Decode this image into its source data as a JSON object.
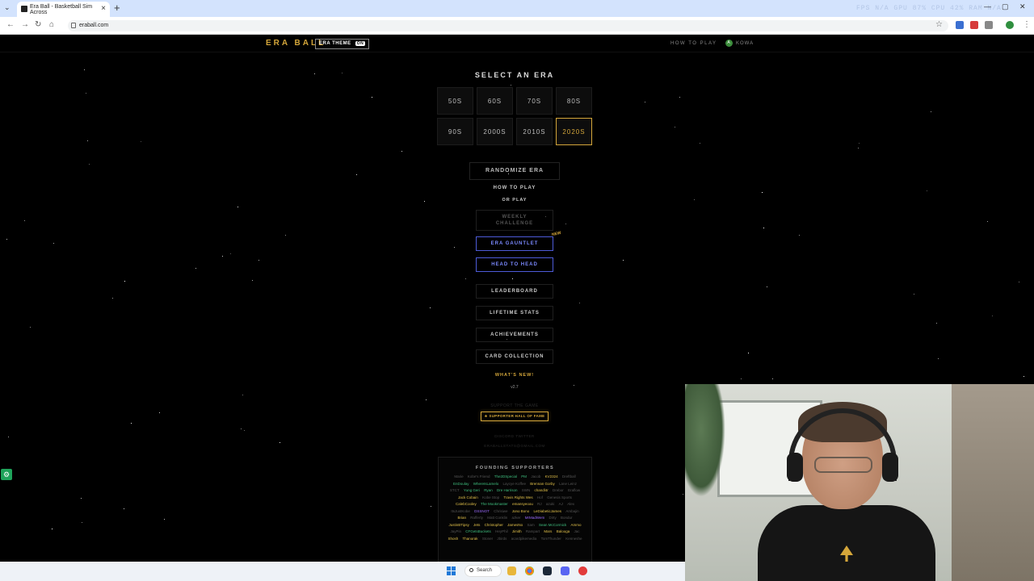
{
  "browser": {
    "tab_title": "Era Ball - Basketball Sim Across",
    "new_tab": "+",
    "url": "eraball.com",
    "stats": "FPS N/A   GPU 87%   CPU 42%   RAM N/A"
  },
  "site": {
    "logo": "ERA BALL",
    "era_theme_label": "ERA THEME",
    "era_theme_state": "ON",
    "how_to_play_nav": "HOW TO PLAY",
    "user_initial": "A",
    "user_name": "KOWA"
  },
  "era_select": {
    "title": "SELECT AN ERA",
    "eras": [
      "50S",
      "60S",
      "70S",
      "80S",
      "90S",
      "2000S",
      "2010S",
      "2020S"
    ],
    "selected": "2020S"
  },
  "menu": {
    "randomize": "RANDOMIZE ERA",
    "how_to_play": "HOW TO PLAY",
    "or_play": "OR PLAY",
    "weekly_challenge": "WEEKLY CHALLENGE",
    "era_gauntlet": "ERA GAUNTLET",
    "new_badge": "NEW",
    "head_to_head": "HEAD TO HEAD",
    "leaderboard": "LEADERBOARD",
    "lifetime_stats": "LIFETIME STATS",
    "achievements": "ACHIEVEMENTS",
    "card_collection": "CARD COLLECTION",
    "whats_new": "WHAT'S NEW!",
    "version": "v2.7",
    "support_text": "SUPPORT THE GAME",
    "supporter_hof": "★ SUPPORTER HALL OF FAME",
    "dim_links_1": "DISCORD   TWITTER",
    "dim_links_2": "ERABALLSTATS@GMAIL.COM"
  },
  "founders": {
    "title": "FOUNDING SUPPORTERS",
    "names": [
      {
        "n": "Marie",
        "c": "#555"
      },
      {
        "n": "Kobe's Friend",
        "c": "#555"
      },
      {
        "n": "The2DSpecial",
        "c": "#3fbf7f"
      },
      {
        "n": "PM",
        "c": "#3fbf7f"
      },
      {
        "n": "Jacob",
        "c": "#555"
      },
      {
        "n": "KV2324",
        "c": "#e2c14a"
      },
      {
        "n": "Dreftball",
        "c": "#555"
      },
      {
        "n": "EnDoulay",
        "c": "#3fbf7f"
      },
      {
        "n": "WhereIsLamelo",
        "c": "#3fbf7f"
      },
      {
        "n": "Laycye Koffee",
        "c": "#555"
      },
      {
        "n": "Brennan Gorby",
        "c": "#e2c14a"
      },
      {
        "n": "Lane Leinz",
        "c": "#555"
      },
      {
        "n": "STCT",
        "c": "#555"
      },
      {
        "n": "Yung Geri",
        "c": "#3fbf7f"
      },
      {
        "n": "Ryan",
        "c": "#3fbf7f"
      },
      {
        "n": "Dre Harrison",
        "c": "#3fbf7f"
      },
      {
        "n": "SWN",
        "c": "#555"
      },
      {
        "n": "chandl4r",
        "c": "#e2c14a"
      },
      {
        "n": "Drebor",
        "c": "#555"
      },
      {
        "n": "Eraflow",
        "c": "#555"
      },
      {
        "n": "Jack Cobain",
        "c": "#e2c14a"
      },
      {
        "n": "Kobe Stop",
        "c": "#555"
      },
      {
        "n": "Travis Rights Wes",
        "c": "#e2c14a"
      },
      {
        "n": "Hof",
        "c": "#555"
      },
      {
        "n": "Genesis Sports",
        "c": "#555"
      },
      {
        "n": "CalebCooley",
        "c": "#e2c14a"
      },
      {
        "n": "The Mookmaster",
        "c": "#3fbf7f"
      },
      {
        "n": "emansyeoou",
        "c": "#e2c14a"
      },
      {
        "n": "RJ",
        "c": "#555"
      },
      {
        "n": "azuki",
        "c": "#555"
      },
      {
        "n": "AJ",
        "c": "#555"
      },
      {
        "n": "Alex",
        "c": "#555"
      },
      {
        "n": "ItsJustKobe",
        "c": "#555"
      },
      {
        "n": "DSSNOT",
        "c": "#9b6bff"
      },
      {
        "n": "Chrisiwe",
        "c": "#555"
      },
      {
        "n": "Jono Bono",
        "c": "#e2c14a"
      },
      {
        "n": "LeDiabeticJames",
        "c": "#e2c14a"
      },
      {
        "n": "Ambajin",
        "c": "#555"
      },
      {
        "n": "Brian",
        "c": "#e2c14a"
      },
      {
        "n": "Rafferty",
        "c": "#555"
      },
      {
        "n": "Matt Conklin",
        "c": "#555"
      },
      {
        "n": "azker",
        "c": "#555"
      },
      {
        "n": "MrMadWem",
        "c": "#9b6bff"
      },
      {
        "n": "Dirty",
        "c": "#555"
      },
      {
        "n": "Bondur",
        "c": "#555"
      },
      {
        "n": "JustinBTipsy",
        "c": "#e2c14a"
      },
      {
        "n": "Jets",
        "c": "#e2c14a"
      },
      {
        "n": "Christopher",
        "c": "#e2c14a"
      },
      {
        "n": "JamesNo",
        "c": "#e2c14a"
      },
      {
        "n": "Sam",
        "c": "#555"
      },
      {
        "n": "Sean McCormick",
        "c": "#3fbf7f"
      },
      {
        "n": "Ammo",
        "c": "#e2c14a"
      },
      {
        "n": "JayPin",
        "c": "#555"
      },
      {
        "n": "CFGetsBuckets",
        "c": "#3fbf7f"
      },
      {
        "n": "HeyPhil",
        "c": "#555"
      },
      {
        "n": "Jimith",
        "c": "#e2c14a"
      },
      {
        "n": "Rampart",
        "c": "#555"
      },
      {
        "n": "Mars",
        "c": "#e2c14a"
      },
      {
        "n": "Balooga",
        "c": "#e2c14a"
      },
      {
        "n": "Jac",
        "c": "#555"
      },
      {
        "n": "Shosh",
        "c": "#e2c14a"
      },
      {
        "n": "Thanorak",
        "c": "#e2c14a"
      },
      {
        "n": "Stoner",
        "c": "#555"
      },
      {
        "n": "Jbirds",
        "c": "#555"
      },
      {
        "n": "acardpikemedia",
        "c": "#555"
      },
      {
        "n": "TomThunder",
        "c": "#555"
      },
      {
        "n": "Kenneshe",
        "c": "#555"
      }
    ]
  },
  "taskbar": {
    "search": "Search"
  },
  "colors": {
    "accent_gold": "#d4a63a",
    "accent_blue": "#4d5bd8"
  }
}
